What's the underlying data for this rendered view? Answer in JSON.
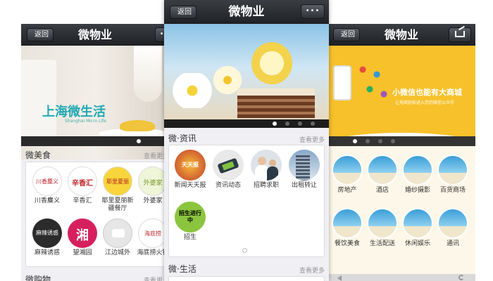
{
  "nav": {
    "title": "微物业",
    "back_label": "返回",
    "more_label": "•••"
  },
  "left_phone": {
    "banner_title": "上海微生活",
    "banner_subtitle": "Shanghai Micro Life",
    "section_title": "微美食",
    "section_more": "查看更多",
    "items": [
      {
        "label": "川香麋义",
        "logo_text": "川香麋义"
      },
      {
        "label": "辛香汇",
        "logo_text": "辛香汇"
      },
      {
        "label": "耶里夏丽新疆餐厅",
        "logo_text": "耶里夏丽"
      },
      {
        "label": "外婆家",
        "logo_text": "外婆家"
      },
      {
        "label": "麻辣诱惑",
        "logo_text": "麻辣诱惑"
      },
      {
        "label": "望湘园",
        "logo_text": "湘"
      },
      {
        "label": "江边城外",
        "logo_text": ""
      },
      {
        "label": "海底捞火锅",
        "logo_text": "海底捞"
      }
    ],
    "section2_title": "微购物",
    "section2_more": "查看更多"
  },
  "center_phone": {
    "section_title": "微·资讯",
    "section_more": "查看更多",
    "items": [
      {
        "label": "新闻天天报",
        "logo_text": "天天报"
      },
      {
        "label": "资讯动态",
        "logo_text": ""
      },
      {
        "label": "招聘求职",
        "logo_text": ""
      },
      {
        "label": "出租转让",
        "logo_text": ""
      },
      {
        "label": "招生",
        "logo_text": "招生进行中"
      }
    ],
    "section2_title": "微·生活",
    "section2_more": "查看更多"
  },
  "right_phone": {
    "banner_title": "小微信也能有大商城",
    "banner_subtitle": "让电商轻松进入您的微信公众号",
    "items": [
      {
        "label": "房地产"
      },
      {
        "label": "酒店"
      },
      {
        "label": "婚纱摄影"
      },
      {
        "label": "百货商场"
      },
      {
        "label": "餐饮美食"
      },
      {
        "label": "生活配送"
      },
      {
        "label": "休闲娱乐"
      },
      {
        "label": "通讯"
      }
    ]
  },
  "colors": {
    "nav_bg": "#2a2c30",
    "page_bg": "#efeff4",
    "banner_right_bg": "#f7c12b"
  }
}
